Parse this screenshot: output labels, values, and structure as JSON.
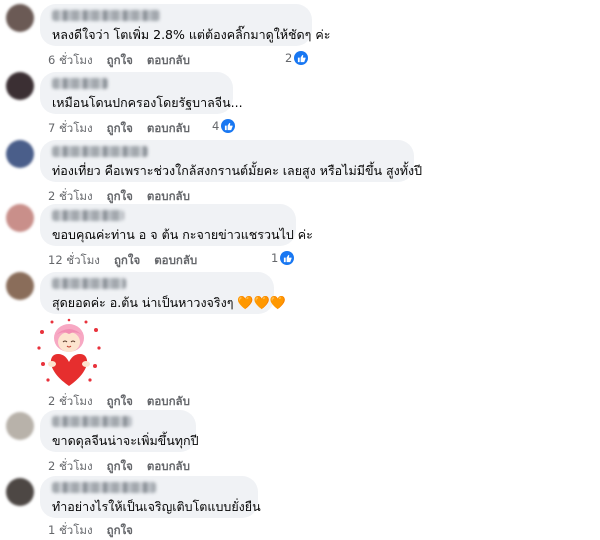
{
  "comments": [
    {
      "text": "หลงดีใจว่า โตเพิ่ม 2.8% แต่ต้องคลิ๊กมาดูให้ชัดๆ ค่ะ",
      "time": "6 ชั่วโมง",
      "like": "ถูกใจ",
      "reply": "ตอบกลับ",
      "reactions": "2",
      "avatar_color": "#6b5a55"
    },
    {
      "text": "เหมือนโดนปกครองโดยรัฐบาลจีน...",
      "time": "7 ชั่วโมง",
      "like": "ถูกใจ",
      "reply": "ตอบกลับ",
      "reactions": "4",
      "avatar_color": "#3b2f33"
    },
    {
      "text": "ท่องเที่ยว คือเพราะช่วงใกล้สงกรานต์มั้ยคะ เลยสูง หรือไม่มีขึ้น สูงทั้งปี",
      "time": "2 ชั่วโมง",
      "like": "ถูกใจ",
      "reply": "ตอบกลับ",
      "reactions": "",
      "avatar_color": "#4a5e8a"
    },
    {
      "text": "ขอบคุณค่ะท่าน อ จ ต้น กะจายข่าวแชรวนไป ค่ะ",
      "time": "12 ชั่วโมง",
      "like": "ถูกใจ",
      "reply": "ตอบกลับ",
      "reactions": "1",
      "avatar_color": "#c98f8a"
    },
    {
      "text": "สุดยอดค่ะ อ.ต้น น่าเป็นหาวงจริงๆ",
      "hearts": "🧡🧡🧡",
      "time": "2 ชั่วโมง",
      "like": "ถูกใจ",
      "reply": "ตอบกลับ",
      "reactions": "",
      "avatar_color": "#8a6d5a"
    },
    {
      "text": "ขาดดุลจีนน่าจะเพิ่มขึ้นทุกปี",
      "time": "2 ชั่วโมง",
      "like": "ถูกใจ",
      "reply": "ตอบกลับ",
      "reactions": "",
      "avatar_color": "#b8b2aa"
    },
    {
      "text": "ทำอย่างไรให้เป็นเจริญเติบโตแบบยั่งยืน",
      "time": "1 ชั่วโมง",
      "like": "ถูกใจ",
      "reply": "",
      "reactions": "",
      "avatar_color": "#4d4744"
    }
  ],
  "colors": {
    "like_blue": "#1877f2",
    "bubble": "#f0f2f5",
    "meta": "#65676b"
  }
}
